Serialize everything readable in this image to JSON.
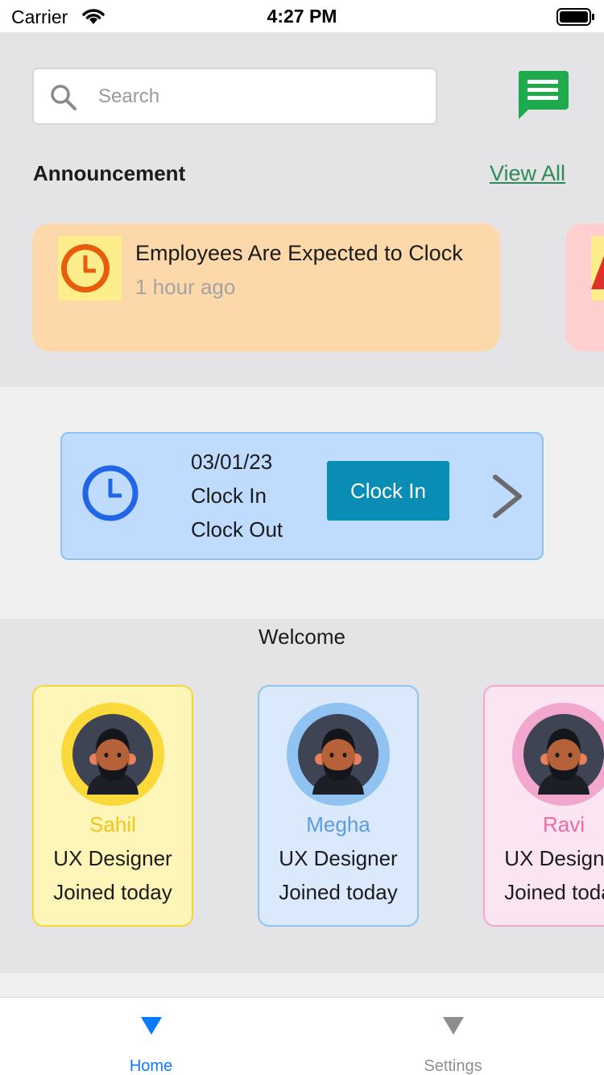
{
  "status_bar": {
    "carrier": "Carrier",
    "time": "4:27 PM"
  },
  "search": {
    "placeholder": "Search",
    "value": ""
  },
  "announcement": {
    "section_title": "Announcement",
    "view_all_label": "View All",
    "items": [
      {
        "title": "Employees Are Expected to Clock",
        "time": "1 hour ago"
      }
    ]
  },
  "attendance": {
    "date": "03/01/23",
    "clock_in_label": "Clock In",
    "clock_out_label": "Clock Out",
    "button_label": "Clock In"
  },
  "welcome": {
    "title": "Welcome",
    "employees": [
      {
        "name": "Sahil",
        "role": "UX Designer",
        "status": "Joined today"
      },
      {
        "name": "Megha",
        "role": "UX Designer",
        "status": "Joined today"
      },
      {
        "name": "Ravi",
        "role": "UX Designer",
        "status": "Joined today"
      }
    ]
  },
  "tabs": [
    {
      "label": "Home",
      "active": true
    },
    {
      "label": "Settings",
      "active": false
    }
  ],
  "colors": {
    "accent": "#0a7aff",
    "clock_button": "#0a8db5",
    "view_all": "#2e8b57",
    "chat_icon": "#1faa4e"
  }
}
